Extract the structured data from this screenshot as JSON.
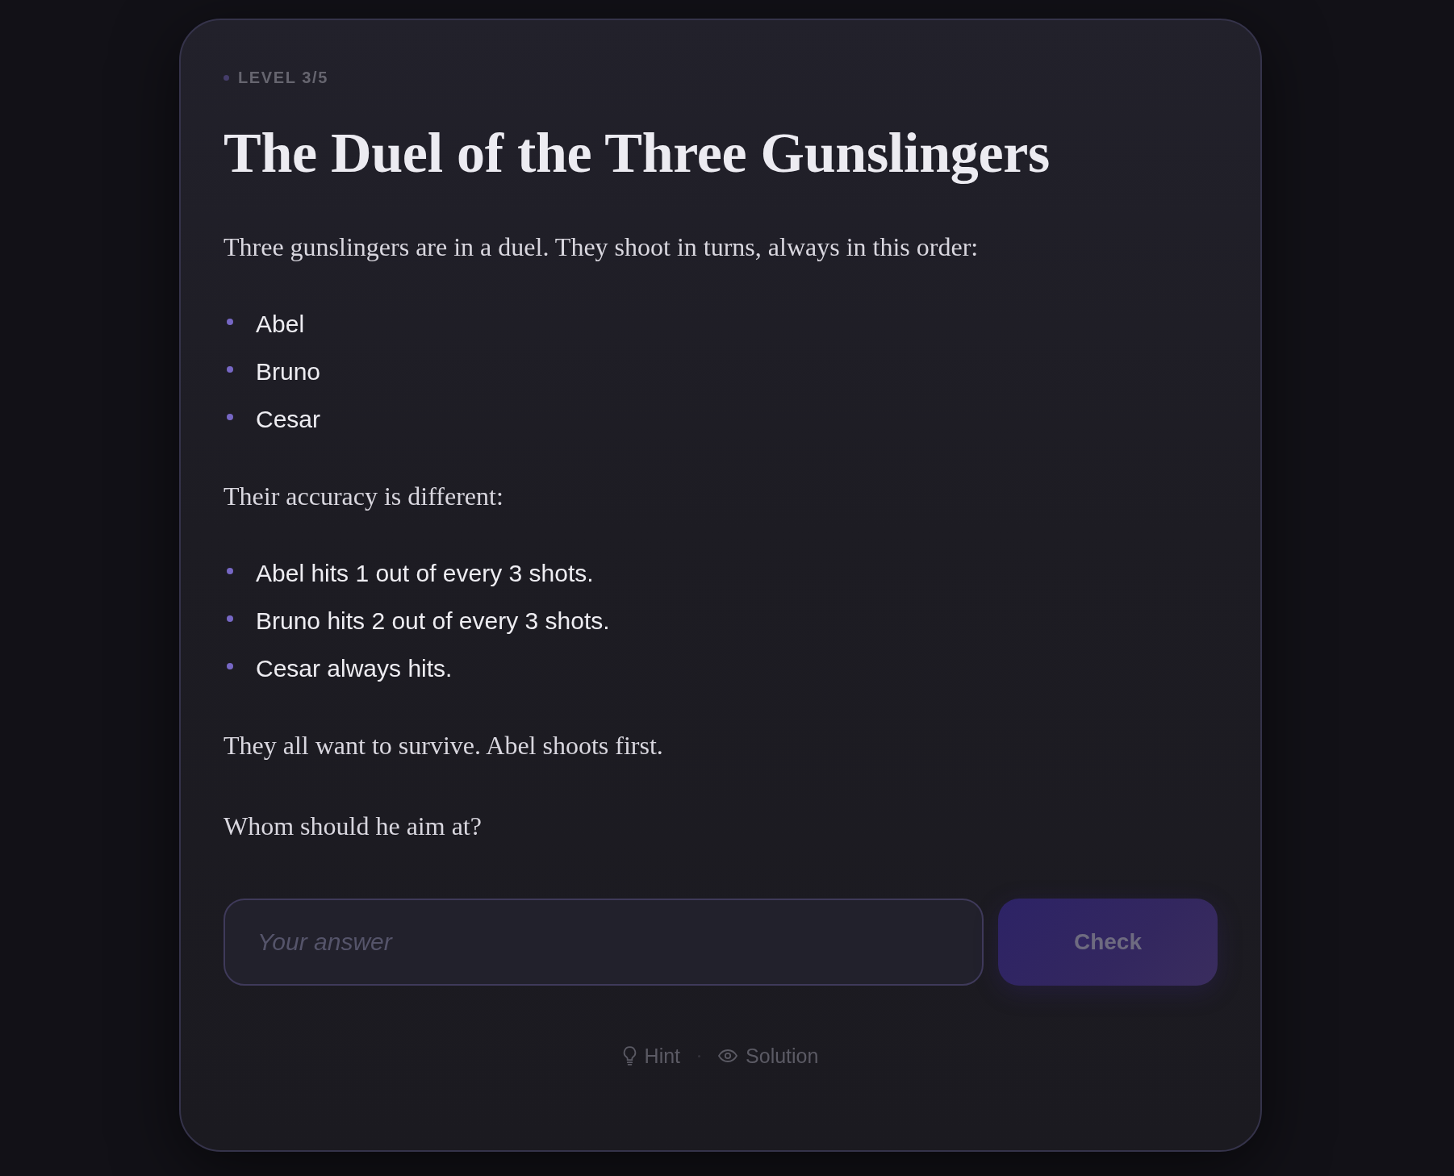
{
  "level_label": "LEVEL 3/5",
  "title": "The Duel of the Three Gunslingers",
  "content": [
    {
      "kind": "paragraph",
      "text": "Three gunslingers are in a duel. They shoot in turns, always in this order:"
    },
    {
      "kind": "list",
      "items": [
        "Abel",
        "Bruno",
        "Cesar"
      ]
    },
    {
      "kind": "paragraph",
      "text": "Their accuracy is different:"
    },
    {
      "kind": "list",
      "items": [
        "Abel hits 1 out of every 3 shots.",
        "Bruno hits 2 out of every 3 shots.",
        "Cesar always hits."
      ]
    },
    {
      "kind": "paragraph",
      "text": "They all want to survive. Abel shoots first."
    },
    {
      "kind": "question",
      "text": "Whom should he aim at?"
    }
  ],
  "answer": {
    "placeholder": "Your answer"
  },
  "check_button": {
    "label": "Check",
    "disabled": true
  },
  "links": [
    {
      "kind": "hint",
      "label": "Hint"
    },
    {
      "kind": "solution",
      "label": "Solution"
    }
  ]
}
